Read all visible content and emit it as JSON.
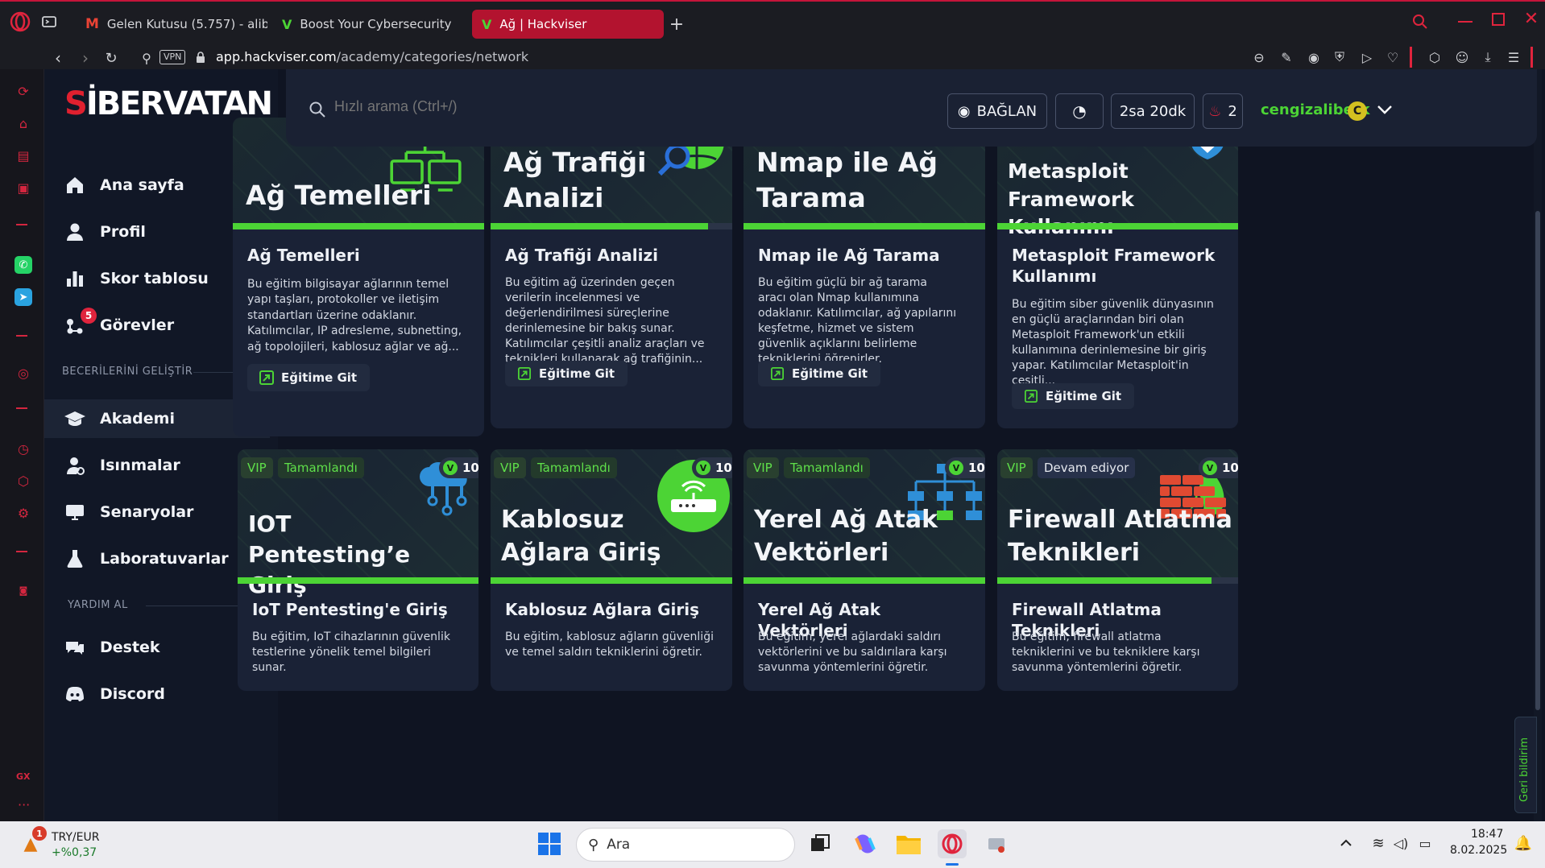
{
  "browser": {
    "tabs": [
      {
        "title": "Gelen Kutusu (5.757) - alib",
        "icon": "gmail-icon"
      },
      {
        "title": "Boost Your Cybersecurity",
        "icon": "hackviser-icon"
      },
      {
        "title": "Ağ | Hackviser",
        "icon": "hackviser-icon",
        "active": true
      }
    ],
    "url_domain": "app.hackviser.com",
    "url_path": "/academy/categories/network",
    "vpn_label": "VPN"
  },
  "sidebar": {
    "logo_part1": "S",
    "logo_part2": "İBERVATAN",
    "nav": [
      {
        "label": "Ana sayfa",
        "icon": "home-icon"
      },
      {
        "label": "Profil",
        "icon": "user-icon"
      },
      {
        "label": "Skor tablosu",
        "icon": "chart-icon"
      },
      {
        "label": "Görevler",
        "icon": "tasks-icon",
        "badge": "5"
      }
    ],
    "section1": "BECERİLERİNİ GELİŞTİR",
    "nav2": [
      {
        "label": "Akademi",
        "icon": "graduation-icon",
        "active": true
      },
      {
        "label": "Isınmalar",
        "icon": "warmup-icon"
      },
      {
        "label": "Senaryolar",
        "icon": "scenario-icon"
      },
      {
        "label": "Laboratuvarlar",
        "icon": "flask-icon"
      }
    ],
    "section2": "YARDIM AL",
    "nav3": [
      {
        "label": "Destek",
        "icon": "chat-icon"
      },
      {
        "label": "Discord",
        "icon": "discord-icon"
      }
    ]
  },
  "topbar": {
    "search_placeholder": "Hızlı arama (Ctrl+/)",
    "connect_label": "BAĞLAN",
    "timer": "2sa 20dk",
    "streak": "2",
    "username": "cengizaliberk",
    "avatar_letter": "C"
  },
  "cards_row1": [
    {
      "hero": "Ağ Temelleri",
      "title": "Ağ Temelleri",
      "desc": "Bu eğitim bilgisayar ağlarının temel yapı taşları, protokoller ve iletişim standartları üzerine odaklanır. Katılımcılar, IP adresleme, subnetting, ağ topolojileri, kablosuz ağlar ve ağ...",
      "button": "Eğitime Git",
      "progress": 1.0
    },
    {
      "hero": "Ağ Trafiği Analizi",
      "title": "Ağ Trafiği Analizi",
      "desc": "Bu eğitim ağ üzerinden geçen verilerin incelenmesi ve değerlendirilmesi süreçlerine derinlemesine bir bakış sunar. Katılımcılar çeşitli analiz araçları ve teknikleri kullanarak ağ trafiğinin...",
      "button": "Eğitime Git",
      "progress": 0.9
    },
    {
      "hero": "Nmap ile Ağ Tarama",
      "title": "Nmap ile Ağ Tarama",
      "desc": "Bu eğitim güçlü bir ağ tarama aracı olan Nmap kullanımına odaklanır. Katılımcılar, ağ yapılarını keşfetme, hizmet ve sistem güvenlik açıklarını belirleme tekniklerini öğrenirler.",
      "button": "Eğitime Git",
      "progress": 1.0
    },
    {
      "hero": "Metasploit Framework Kullanımı",
      "title": "Metasploit Framework Kullanımı",
      "desc": "Bu eğitim siber güvenlik dünyasının en güçlü araçlarından biri olan Metasploit Framework'un etkili kullanımına derinlemesine bir giriş yapar. Katılımcılar Metasploit'in çeşitli...",
      "button": "Eğitime Git",
      "progress": 1.0
    }
  ],
  "cards_row2": [
    {
      "vip": "VIP",
      "status": "Tamamlandı",
      "points": "10",
      "hero": "IOT Pentesting’e Giriş",
      "title": "IoT Pentesting'e Giriş",
      "desc": "Bu eğitim, IoT cihazlarının güvenlik testlerine yönelik temel bilgileri sunar.",
      "progress": 1.0
    },
    {
      "vip": "VIP",
      "status": "Tamamlandı",
      "points": "10",
      "hero": "Kablosuz Ağlara Giriş",
      "title": "Kablosuz Ağlara Giriş",
      "desc": "Bu eğitim, kablosuz ağların güvenliği ve temel saldırı tekniklerini öğretir.",
      "progress": 1.0
    },
    {
      "vip": "VIP",
      "status": "Tamamlandı",
      "points": "10",
      "hero": "Yerel Ağ Atak Vektörleri",
      "title": "Yerel Ağ Atak Vektörleri",
      "desc": "Bu eğitim, yerel ağlardaki saldırı vektörlerini ve bu saldırılara karşı savunma yöntemlerini öğretir.",
      "progress": 1.0
    },
    {
      "vip": "VIP",
      "status": "Devam ediyor",
      "points": "10",
      "hero": "Firewall Atlatma Teknikleri",
      "title": "Firewall Atlatma Teknikleri",
      "desc": "Bu eğitim, firewall atlatma tekniklerini ve bu tekniklere karşı savunma yöntemlerini öğretir.",
      "progress": 0.89
    }
  ],
  "feedback": "Geri bildirim",
  "taskbar": {
    "currency": "TRY/EUR",
    "change": "+%0,37",
    "badge": "1",
    "search": "Ara",
    "time": "18:47",
    "date": "8.02.2025"
  },
  "colors": {
    "accent": "#4cd435",
    "opera_red": "#c4143a"
  }
}
